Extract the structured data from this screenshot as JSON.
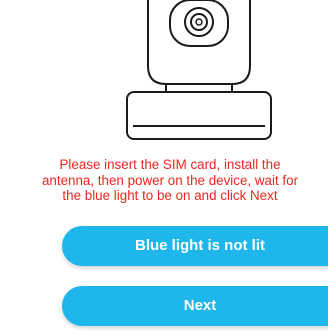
{
  "illustration": {
    "icon": "security-camera-icon"
  },
  "instruction": {
    "line1": "Please insert the SIM card, install the",
    "line2": "antenna, then power on the device, wait for",
    "line3": "the blue light to be on and click Next"
  },
  "buttons": {
    "not_lit_label": "Blue light is not lit",
    "next_label": "Next"
  },
  "colors": {
    "instruction_text": "#e8281f",
    "button_background": "#1fb6ec",
    "button_text": "#ffffff"
  }
}
